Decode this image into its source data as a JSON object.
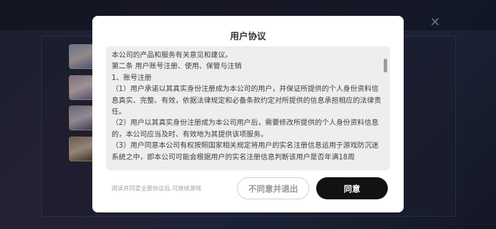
{
  "background": {
    "close_icon_glyph": "✕"
  },
  "dialog": {
    "title": "用户协议",
    "content": [
      "本公司的产品和服务有关意见和建议。",
      "第二条 用户账号注册、使用、保管与注销",
      "1、账号注册",
      "（1）用户承诺以其真实身份注册成为本公司的用户，并保证所提供的个人身份资料信息真实、完整、有效，依据法律规定和必备条款约定对所提供的信息承担相应的法律责任。",
      "（2）用户以其真实身份注册成为本公司用户后，需要修改所提供的个人身份资料信息的，本公司应当及时、有效地为其提供该项服务。",
      "（3）用户同意本公司有权按照国家相关规定将用户的实名注册信息运用于游戏防沉迷系统之中，即本公司可能会根据用户的实名注册信息判断该用户是否年满18周"
    ],
    "footer_hint": "阅读并同意全部协议后,可继续游戏",
    "disagree_label": "不同意并退出",
    "agree_label": "同意"
  }
}
